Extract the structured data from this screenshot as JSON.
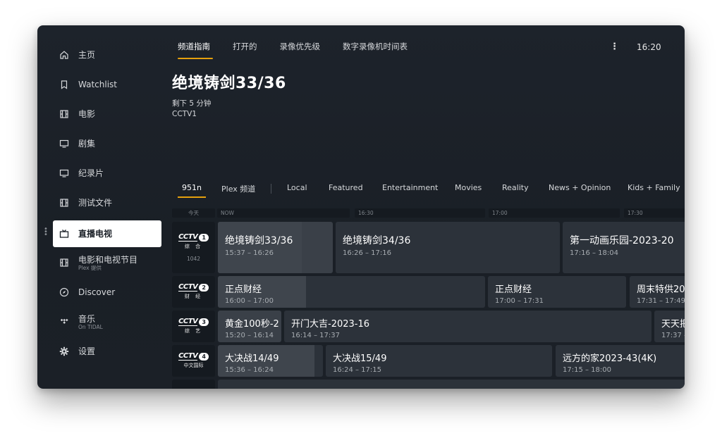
{
  "sidebar": {
    "items": [
      {
        "label": "主页",
        "sub": "",
        "icon": "home-icon"
      },
      {
        "label": "Watchlist",
        "sub": "",
        "icon": "bookmark-icon"
      },
      {
        "label": "电影",
        "sub": "",
        "icon": "film-icon"
      },
      {
        "label": "剧集",
        "sub": "",
        "icon": "tv-monitor-icon"
      },
      {
        "label": "纪录片",
        "sub": "",
        "icon": "tv-monitor-icon"
      },
      {
        "label": "测试文件",
        "sub": "",
        "icon": "film-icon"
      },
      {
        "label": "直播电视",
        "sub": "",
        "icon": "live-tv-icon"
      },
      {
        "label": "电影和电视节目",
        "sub": "Plex 提供",
        "icon": "film-icon"
      },
      {
        "label": "Discover",
        "sub": "",
        "icon": "compass-icon"
      },
      {
        "label": "音乐",
        "sub": "On TIDAL",
        "icon": "tidal-icon"
      },
      {
        "label": "设置",
        "sub": "",
        "icon": "gear-icon"
      }
    ]
  },
  "topnav": {
    "tabs": [
      "频道指南",
      "打开的",
      "录像优先级",
      "数字录像机时间表"
    ],
    "clock": "16:20"
  },
  "hero": {
    "title": "绝境铸剑33/36",
    "remaining": "剩下 5 分钟",
    "channel": "CCTV1"
  },
  "categories": [
    "951n",
    "Plex 频道",
    "Local",
    "Featured",
    "Entertainment",
    "Movies",
    "Reality",
    "News + Opinion",
    "Kids + Family"
  ],
  "timeline": [
    "今天",
    "NOW",
    "16:30",
    "17:00",
    "17:30"
  ],
  "channels": [
    {
      "brand": "CCTV",
      "num": "1",
      "sub": "综 合",
      "number": "1042"
    },
    {
      "brand": "CCTV",
      "num": "2",
      "sub": "财 经",
      "number": ""
    },
    {
      "brand": "CCTV",
      "num": "3",
      "sub": "综 艺",
      "number": ""
    },
    {
      "brand": "CCTV",
      "num": "4",
      "sub": "中文国际",
      "number": ""
    }
  ],
  "programs": [
    [
      {
        "title": "绝境铸剑33/36",
        "time": "15:37 – 16:26",
        "progress": 0.73
      },
      {
        "title": "绝境铸剑34/36",
        "time": "16:26 – 17:16"
      },
      {
        "title": "第一动画乐园-2023-20",
        "time": "17:16 – 18:04"
      }
    ],
    [
      {
        "title": "正点财经",
        "time": "16:00 – 17:00",
        "progress": 0.33
      },
      {
        "title": "正点财经",
        "time": "17:00 – 17:31"
      },
      {
        "title": "周末特供20",
        "time": "17:31 – 17:49"
      }
    ],
    [
      {
        "title": "黄金100秒-2",
        "time": "15:20 – 16:14"
      },
      {
        "title": "开门大吉-2023-16",
        "time": "16:14 – 17:37"
      },
      {
        "title": "天天把",
        "time": "17:37 –"
      }
    ],
    [
      {
        "title": "大决战14/49",
        "time": "15:36 – 16:24",
        "progress": 0.92
      },
      {
        "title": "大决战15/49",
        "time": "16:24 – 17:15"
      },
      {
        "title": "远方的家2023-43(4K)",
        "time": "17:15 – 18:00"
      }
    ]
  ],
  "colors": {
    "accent": "#e5a00d",
    "background": "#1b2027",
    "cell": "#2c323a"
  }
}
